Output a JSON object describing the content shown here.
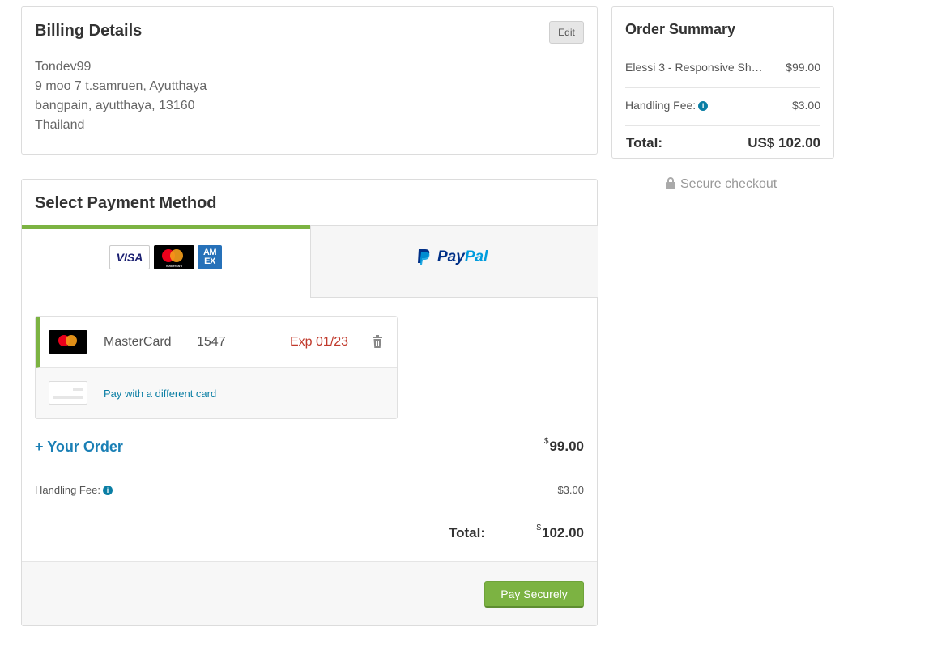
{
  "billing": {
    "title": "Billing Details",
    "edit_label": "Edit",
    "address_lines": [
      "Tondev99",
      "9 moo 7 t.samruen, Ayutthaya",
      "bangpain, ayutthaya, 13160",
      "Thailand"
    ]
  },
  "payment": {
    "title": "Select Payment Method",
    "tabs": {
      "card": {
        "logos": [
          "VISA",
          "mastercard",
          "AMEX"
        ],
        "active": true,
        "visa_text": "VISA",
        "amex_text": "AM EX",
        "mc_text": "mastercard"
      },
      "paypal": {
        "brand_part1": "Pay",
        "brand_part2": "Pal",
        "active": false
      }
    },
    "saved_card": {
      "brand": "MasterCard",
      "last4": "1547",
      "expiry": "Exp 01/23"
    },
    "different_card_label": "Pay with a different card",
    "your_order_label": "+ Your Order",
    "order_currency": "$",
    "order_amount": "99.00",
    "handling_fee_label": "Handling Fee:",
    "handling_fee_amount": "$3.00",
    "total_label": "Total:",
    "total_currency": "$",
    "total_amount": "102.00",
    "pay_button_label": "Pay Securely"
  },
  "summary": {
    "title": "Order Summary",
    "item_name": "Elessi 3 - Responsive Sh…",
    "item_amount": "$99.00",
    "handling_fee_label": "Handling Fee:",
    "handling_fee_amount": "$3.00",
    "total_label": "Total:",
    "total_amount": "US$ 102.00"
  },
  "secure_checkout_label": "Secure checkout",
  "colors": {
    "accent_green": "#7cb342",
    "link_blue": "#0a7ea4",
    "expiry_red": "#c0392b",
    "paypal_dark": "#003087",
    "paypal_light": "#009cde"
  },
  "icons": [
    "info-icon",
    "trash-icon",
    "lock-icon",
    "paypal-icon",
    "visa-logo",
    "mastercard-logo",
    "amex-logo"
  ]
}
